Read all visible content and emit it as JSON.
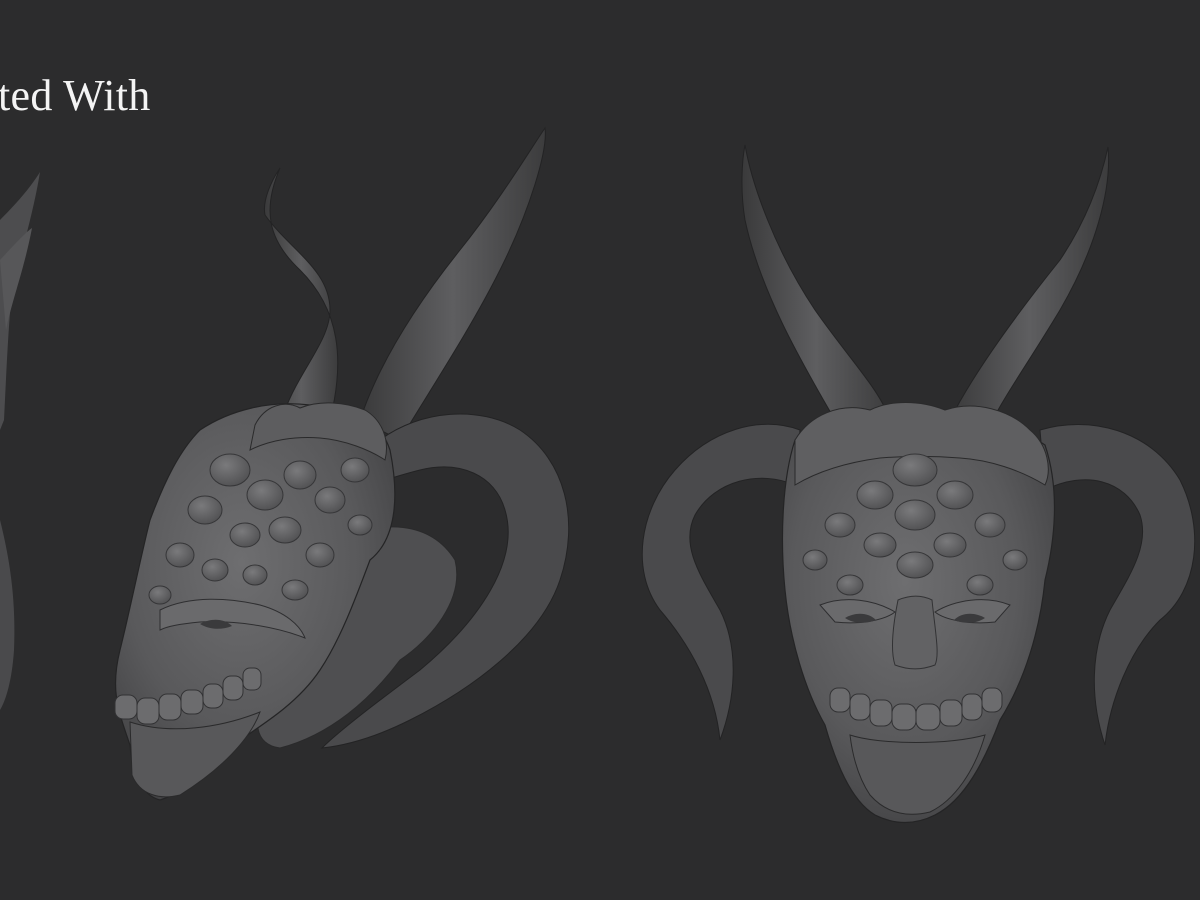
{
  "caption": {
    "text": "ted With"
  },
  "scene": {
    "background_color": "#2c2c2d",
    "caption_color": "#f4f4f4",
    "models": [
      {
        "name": "horned-demon-head",
        "view": "three-quarter"
      },
      {
        "name": "horned-demon-head",
        "view": "front"
      }
    ]
  }
}
